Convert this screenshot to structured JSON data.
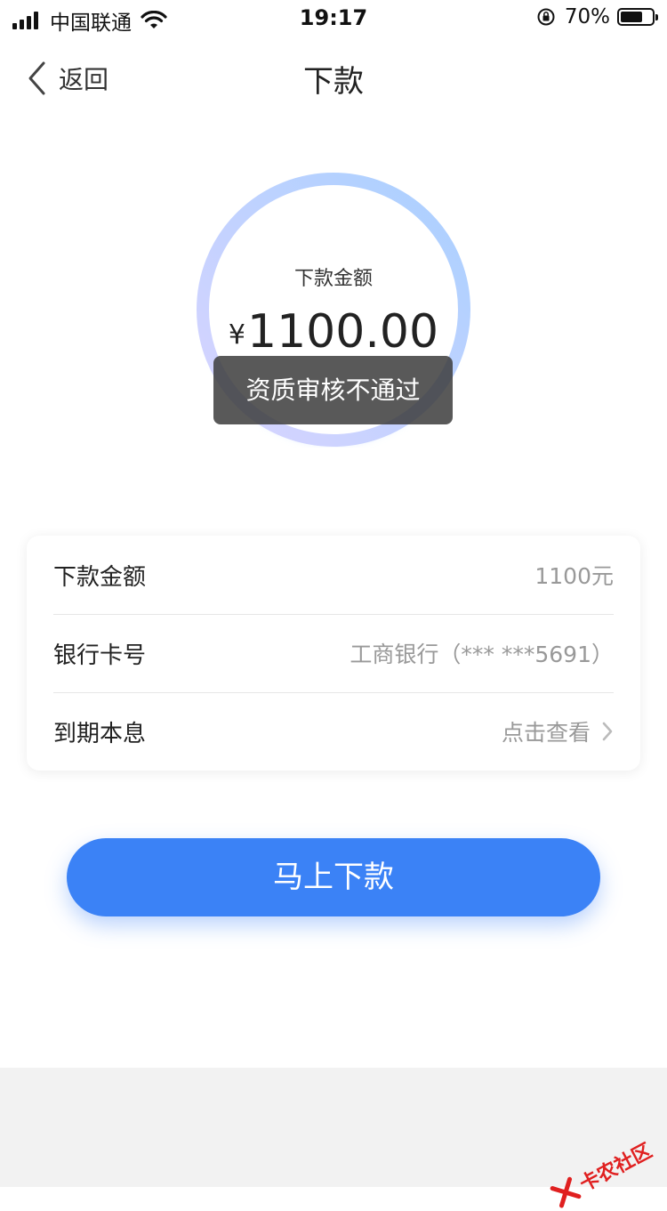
{
  "status_bar": {
    "carrier": "中国联通",
    "time": "19:17",
    "battery": "70%",
    "battery_level": 0.7
  },
  "nav": {
    "back_label": "返回",
    "title": "下款"
  },
  "hero": {
    "label": "下款金额",
    "currency": "¥",
    "amount": "1100.00"
  },
  "toast": {
    "message": "资质审核不通过"
  },
  "info": {
    "rows": [
      {
        "label": "下款金额",
        "value": "1100元"
      },
      {
        "label": "银行卡号",
        "value": "工商银行（*** ***5691）"
      },
      {
        "label": "到期本息",
        "value": "点击查看"
      }
    ]
  },
  "action": {
    "button_label": "马上下款"
  },
  "watermark": {
    "text": "卡农社区"
  },
  "colors": {
    "primary": "#3b82f6",
    "ring_start": "#d9d4ff",
    "ring_end": "#a9d0ff",
    "watermark": "#e02020"
  }
}
